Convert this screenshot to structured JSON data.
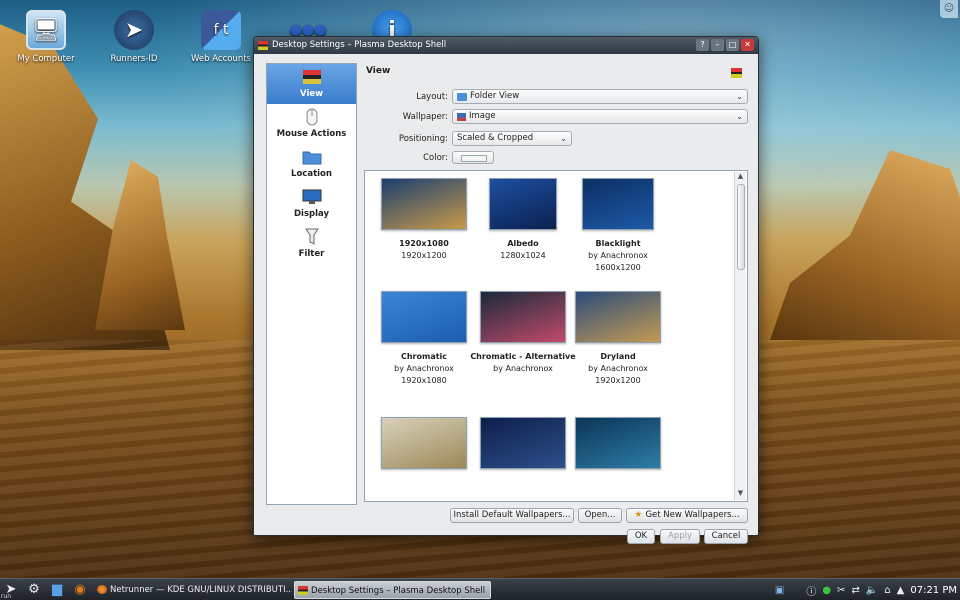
{
  "desktop": {
    "icons": [
      {
        "label": "My Computer",
        "icon": "computer-icon"
      },
      {
        "label": "Runners-ID",
        "icon": "compass-icon"
      },
      {
        "label": "Web Accounts",
        "icon": "social-icon"
      },
      {
        "label": "",
        "icon": "network-icon"
      },
      {
        "label": "",
        "icon": "info-icon"
      }
    ]
  },
  "window": {
    "title": "Desktop Settings – Plasma Desktop Shell",
    "buttons": {
      "help": "?",
      "minimize": "–",
      "maximize": "□",
      "close": "✕"
    }
  },
  "sidebar": {
    "items": [
      {
        "label": "View",
        "icon": "view-icon",
        "active": true
      },
      {
        "label": "Mouse Actions",
        "icon": "mouse-icon",
        "active": false
      },
      {
        "label": "Location",
        "icon": "folder-icon",
        "active": false
      },
      {
        "label": "Display",
        "icon": "monitor-icon",
        "active": false
      },
      {
        "label": "Filter",
        "icon": "filter-icon",
        "active": false
      }
    ]
  },
  "view": {
    "heading": "View",
    "layout": {
      "label": "Layout:",
      "value": "Folder View"
    },
    "wallpaper": {
      "label": "Wallpaper:",
      "value": "Image"
    },
    "positioning": {
      "label": "Positioning:",
      "value": "Scaled & Cropped"
    },
    "color": {
      "label": "Color:"
    }
  },
  "wallpapers": [
    {
      "title": "1920x1080",
      "author": "",
      "size": "1920x1200",
      "colors": [
        "#1b3f70",
        "#c89a4a"
      ]
    },
    {
      "title": "Albedo",
      "author": "",
      "size": "1280x1024",
      "colors": [
        "#1d4fa0",
        "#0b2150"
      ]
    },
    {
      "title": "Blacklight",
      "author": "by Anachronox",
      "size": "1600x1200",
      "colors": [
        "#0c2f63",
        "#1d5aa8"
      ]
    },
    {
      "title": "Chromatic",
      "author": "by Anachronox",
      "size": "1920x1080",
      "colors": [
        "#3b86d4",
        "#1c5db0"
      ]
    },
    {
      "title": "Chromatic - Alternative",
      "author": "by Anachronox",
      "size": "",
      "colors": [
        "#1a2a3a",
        "#c24a6a"
      ]
    },
    {
      "title": "Dryland",
      "author": "by Anachronox",
      "size": "1920x1200",
      "colors": [
        "#2b4c7a",
        "#c49a55"
      ]
    },
    {
      "title": "",
      "author": "",
      "size": "",
      "colors": [
        "#d8d2bb",
        "#9c8858"
      ]
    },
    {
      "title": "",
      "author": "",
      "size": "",
      "colors": [
        "#0d1f4b",
        "#2d4f8a"
      ]
    },
    {
      "title": "",
      "author": "",
      "size": "",
      "colors": [
        "#0b3558",
        "#2d7da6"
      ]
    }
  ],
  "buttons": {
    "install": "Install Default Wallpapers...",
    "open": "Open...",
    "get_new": "Get New Wallpapers...",
    "ok": "OK",
    "apply": "Apply",
    "cancel": "Cancel"
  },
  "taskbar": {
    "run_label": "run",
    "tasks": [
      {
        "label": "Netrunner — KDE GNU/LINUX DISTRIBUTI...",
        "active": false
      },
      {
        "label": "Desktop Settings – Plasma Desktop Shell",
        "active": true
      }
    ],
    "clock": "07:21 PM"
  }
}
